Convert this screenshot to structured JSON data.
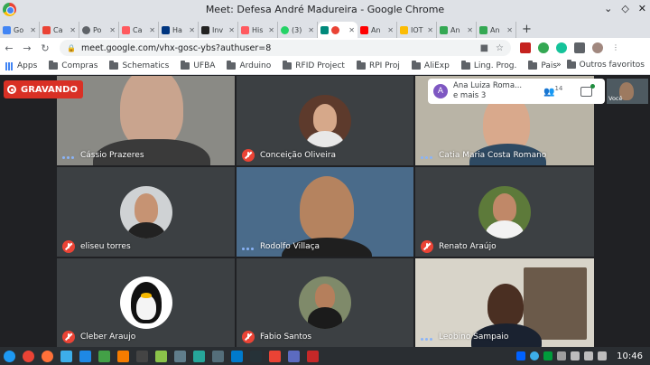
{
  "window": {
    "title": "Meet: Defesa André Madureira - Google Chrome",
    "controls": [
      "⌄",
      "◇",
      "✕"
    ]
  },
  "tabs": [
    {
      "label": "Go",
      "color": "#4285f4"
    },
    {
      "label": "Ca",
      "color": "#ea4335"
    },
    {
      "label": "Po",
      "color": "#5f6368"
    },
    {
      "label": "Ca",
      "color": "#ff5a5f"
    },
    {
      "label": "Ha",
      "color": "#003580"
    },
    {
      "label": "Inv",
      "color": "#222222"
    },
    {
      "label": "His",
      "color": "#ff5a5f"
    },
    {
      "label": "(3)",
      "color": "#25d366"
    },
    {
      "label": "",
      "color": "#00897b",
      "active": true
    },
    {
      "label": "An",
      "color": "#ff0000"
    },
    {
      "label": "IOT",
      "color": "#fbbc05"
    },
    {
      "label": "An",
      "color": "#34a853"
    },
    {
      "label": "An",
      "color": "#34a853"
    }
  ],
  "toolbar": {
    "url": "meet.google.com/vhx-gosc-ybs?authuser=8",
    "back": "←",
    "forward": "→",
    "reload": "↻",
    "lock": "🔒"
  },
  "bookmarks": {
    "items": [
      "Apps",
      "Compras",
      "Schematics",
      "UFBA",
      "Arduino",
      "RFID Project",
      "RPI Proj",
      "AliExp",
      "Ling. Prog.",
      "Pais"
    ],
    "more": "»",
    "other": "Outros favoritos"
  },
  "meet": {
    "recording_label": "GRAVANDO",
    "info": {
      "avatar_letter": "A",
      "text": "Ana Luiza Roma... e mais 3",
      "participants": "14"
    },
    "self_label": "Você",
    "participants": [
      {
        "name": "Cássio Prazeres",
        "state": "talk"
      },
      {
        "name": "Conceição Oliveira",
        "state": "muted"
      },
      {
        "name": "Catia Maria Costa Romano",
        "state": "talk"
      },
      {
        "name": "eliseu torres",
        "state": "muted"
      },
      {
        "name": "Rodolfo Villaça",
        "state": "talk"
      },
      {
        "name": "Renato Araújo",
        "state": "muted"
      },
      {
        "name": "Cleber Araujo",
        "state": "muted"
      },
      {
        "name": "Fabio Santos",
        "state": "muted"
      },
      {
        "name": "Leobino Sampaio",
        "state": "talk"
      }
    ]
  },
  "taskbar": {
    "time": "10:46"
  },
  "colors": {
    "meet_bg": "#202124",
    "tile_bg": "#3c4043",
    "recording": "#d93025",
    "muted": "#ea4335",
    "talking": "#8ab4f8"
  }
}
